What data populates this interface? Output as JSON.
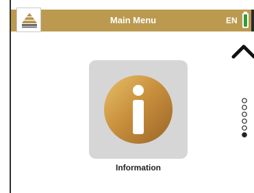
{
  "header": {
    "title": "Main Menu",
    "language": "EN",
    "logo_icon": "pyramid-logo-icon",
    "battery_icon": "battery-full-icon"
  },
  "menu": {
    "items": [
      {
        "label": "Information",
        "icon": "info-icon"
      }
    ],
    "scroll_up_icon": "chevron-up-icon"
  },
  "pagination": {
    "total_pages": 6,
    "current_page": 6
  },
  "colors": {
    "header_gold": "#bb9a4f",
    "tile_gray": "#d6d6d6",
    "battery_green": "#2f9e35"
  }
}
